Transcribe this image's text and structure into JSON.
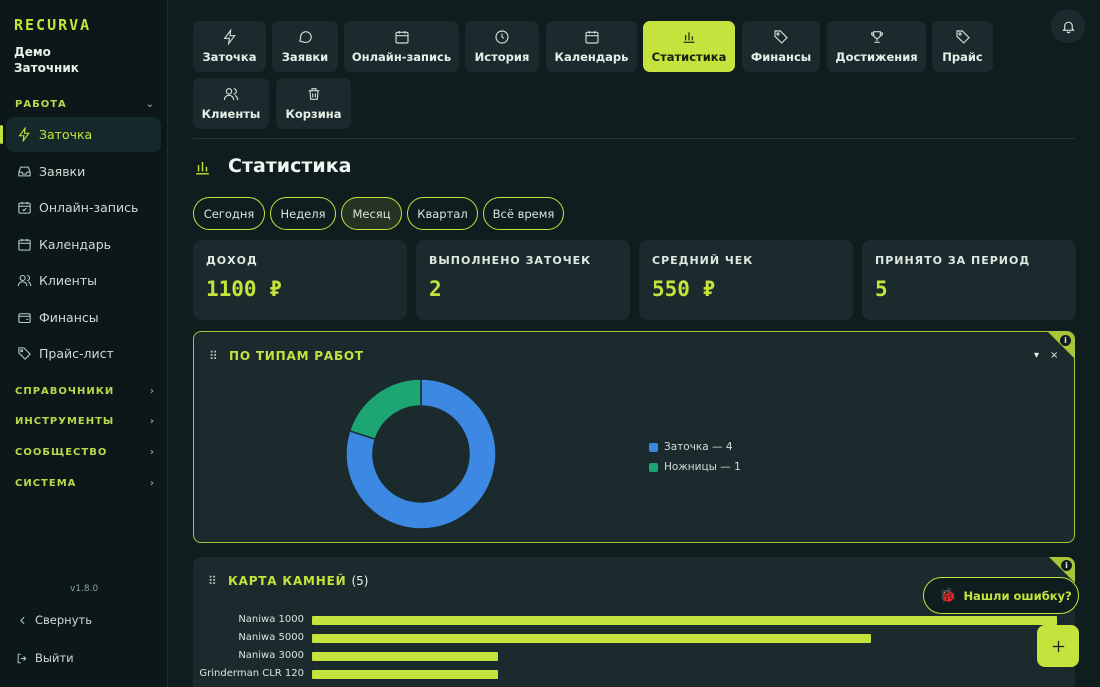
{
  "app": {
    "logo": "RECURVA",
    "user_line1": "Демо",
    "user_line2": "Заточник"
  },
  "sidebar": {
    "section_work": "РАБОТА",
    "items": [
      {
        "label": "Заточка",
        "icon": "bolt-icon"
      },
      {
        "label": "Заявки",
        "icon": "inbox-icon"
      },
      {
        "label": "Онлайн-запись",
        "icon": "calendar-check-icon"
      },
      {
        "label": "Календарь",
        "icon": "calendar-icon"
      },
      {
        "label": "Клиенты",
        "icon": "users-icon"
      },
      {
        "label": "Финансы",
        "icon": "wallet-icon"
      },
      {
        "label": "Прайс-лист",
        "icon": "tag-icon"
      }
    ],
    "sections": [
      "СПРАВОЧНИКИ",
      "ИНСТРУМЕНТЫ",
      "СООБЩЕСТВО",
      "СИСТЕМА"
    ],
    "version": "v1.8.0",
    "collapse": "Свернуть",
    "logout": "Выйти"
  },
  "tabs": [
    {
      "label": "Заточка",
      "icon": "bolt-icon"
    },
    {
      "label": "Заявки",
      "icon": "chat-icon"
    },
    {
      "label": "Онлайн-запись",
      "icon": "calendar-icon"
    },
    {
      "label": "История",
      "icon": "clock-icon"
    },
    {
      "label": "Календарь",
      "icon": "calendar-icon"
    },
    {
      "label": "Статистика",
      "icon": "bar-chart-icon",
      "active": true
    },
    {
      "label": "Финансы",
      "icon": "tag-icon"
    },
    {
      "label": "Достижения",
      "icon": "trophy-icon"
    },
    {
      "label": "Прайс",
      "icon": "tag-icon"
    },
    {
      "label": "Клиенты",
      "icon": "users-icon"
    },
    {
      "label": "Корзина",
      "icon": "trash-icon"
    }
  ],
  "page": {
    "title": "Статистика"
  },
  "periods": [
    "Сегодня",
    "Неделя",
    "Месяц",
    "Квартал",
    "Всё время"
  ],
  "active_period": "Месяц",
  "stats": [
    {
      "label": "ДОХОД",
      "value": "1100 ₽"
    },
    {
      "label": "ВЫПОЛНЕНО ЗАТОЧЕК",
      "value": "2"
    },
    {
      "label": "СРЕДНИЙ ЧЕК",
      "value": "550 ₽"
    },
    {
      "label": "ПРИНЯТО ЗА ПЕРИОД",
      "value": "5"
    }
  ],
  "widget_types": {
    "title": "ПО ТИПАМ РАБОТ",
    "info": "i",
    "collapse_glyph": "▾",
    "close_glyph": "×",
    "legend": [
      "Заточка — 4",
      "Ножницы — 1"
    ]
  },
  "widget_stones": {
    "title": "КАРТА КАМНЕЙ",
    "count": "(5)",
    "info": "i"
  },
  "colors": {
    "accent": "#c4e33c",
    "blue": "#3d88e3",
    "green": "#1ea574"
  },
  "chart_data": [
    {
      "type": "pie",
      "title": "ПО ТИПАМ РАБОТ",
      "categories": [
        "Заточка",
        "Ножницы"
      ],
      "values": [
        4,
        1
      ],
      "colors": [
        "#3d88e3",
        "#1ea574"
      ],
      "donut": true,
      "legend": "right"
    },
    {
      "type": "bar",
      "orientation": "horizontal",
      "title": "КАРТА КАМНЕЙ",
      "categories": [
        "Naniwa 1000",
        "Naniwa 5000",
        "Naniwa 3000",
        "Grinderman CLR 120"
      ],
      "values": [
        4,
        3,
        1,
        1
      ],
      "xlim": [
        0,
        4
      ]
    }
  ],
  "bug_button": "Нашли ошибку?"
}
